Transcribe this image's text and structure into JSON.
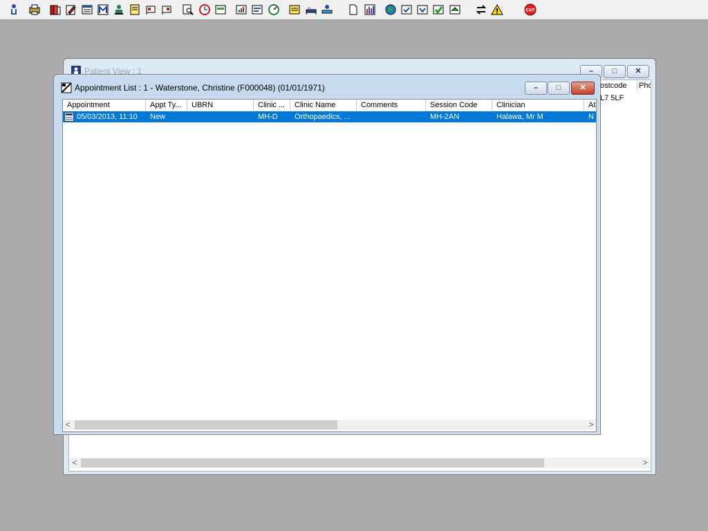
{
  "patient_view": {
    "title": "Patient View : 1",
    "columns": [
      "ostcode",
      "Pho"
    ],
    "row": {
      "postcode": "L7 5LF"
    }
  },
  "appt_list": {
    "title": "Appointment List : 1 - Waterstone, Christine (F000048) (01/01/1971)",
    "columns": [
      "Appointment",
      "Appt Ty...",
      "UBRN",
      "Clinic ...",
      "Clinic Name",
      "Comments",
      "Session Code",
      "Clinician",
      "At"
    ],
    "rows": [
      {
        "appointment": "05/03/2013, 11:10",
        "appt_type": "New",
        "ubrn": "",
        "clinic": "MH-D",
        "clinic_name": "Orthopaedics, ...",
        "comments": "",
        "session_code": "MH-2AN",
        "clinician": "Halawa, Mr M",
        "at": "N"
      }
    ]
  },
  "caption_buttons": {
    "minimize": "–",
    "maximize": "□",
    "close": "✕"
  },
  "scroll": {
    "left": "<",
    "right": ">"
  },
  "toolbar": {
    "exit_label": "EXIT"
  },
  "colors": {
    "selection": "#0078d7",
    "desktop": "#ababab"
  }
}
